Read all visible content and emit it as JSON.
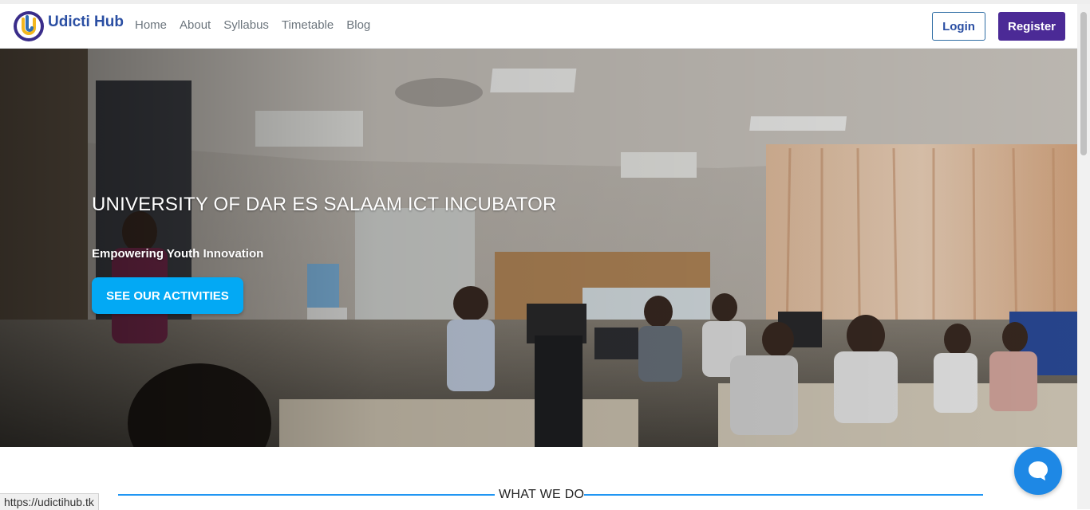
{
  "brand": {
    "name": "Udicti Hub"
  },
  "nav": {
    "links": [
      "Home",
      "About",
      "Syllabus",
      "Timetable",
      "Blog"
    ],
    "login_label": "Login",
    "register_label": "Register"
  },
  "hero": {
    "title": "UNIVERSITY OF DAR ES SALAAM ICT INCUBATOR",
    "subtitle": "Empowering Youth Innovation",
    "cta_label": "SEE OUR ACTIVITIES"
  },
  "section": {
    "title": "WHAT WE DO"
  },
  "status_bar": {
    "url": "https://udictihub.tk"
  },
  "colors": {
    "brand_blue": "#2b4fa3",
    "register_purple": "#4b2a96",
    "cta_blue": "#03a9f4",
    "chat_blue": "#1e88e5",
    "section_line": "#2196f3"
  },
  "icons": {
    "logo": "udicti-logo-icon",
    "chat": "chat-bubble-icon"
  }
}
